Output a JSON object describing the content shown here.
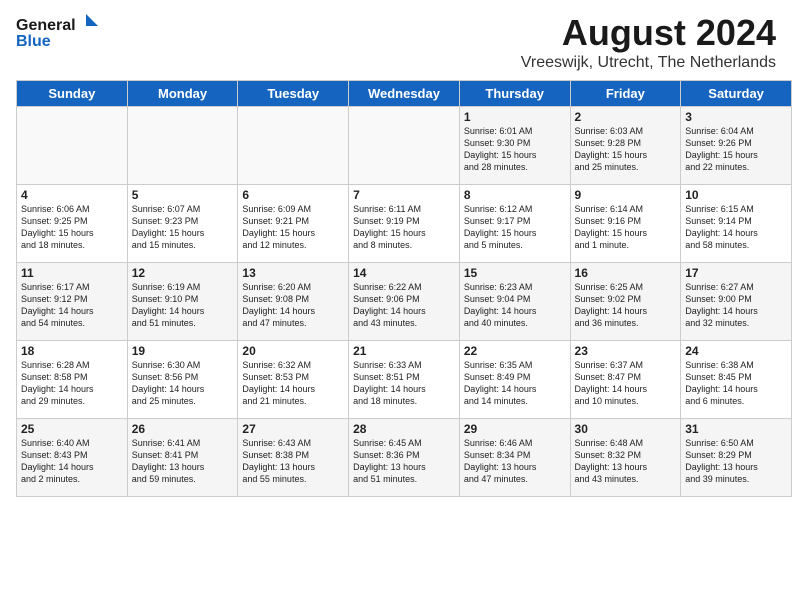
{
  "header": {
    "logo_general": "General",
    "logo_blue": "Blue",
    "main_title": "August 2024",
    "subtitle": "Vreeswijk, Utrecht, The Netherlands"
  },
  "weekdays": [
    "Sunday",
    "Monday",
    "Tuesday",
    "Wednesday",
    "Thursday",
    "Friday",
    "Saturday"
  ],
  "weeks": [
    [
      {
        "day": "",
        "info": ""
      },
      {
        "day": "",
        "info": ""
      },
      {
        "day": "",
        "info": ""
      },
      {
        "day": "",
        "info": ""
      },
      {
        "day": "1",
        "info": "Sunrise: 6:01 AM\nSunset: 9:30 PM\nDaylight: 15 hours\nand 28 minutes."
      },
      {
        "day": "2",
        "info": "Sunrise: 6:03 AM\nSunset: 9:28 PM\nDaylight: 15 hours\nand 25 minutes."
      },
      {
        "day": "3",
        "info": "Sunrise: 6:04 AM\nSunset: 9:26 PM\nDaylight: 15 hours\nand 22 minutes."
      }
    ],
    [
      {
        "day": "4",
        "info": "Sunrise: 6:06 AM\nSunset: 9:25 PM\nDaylight: 15 hours\nand 18 minutes."
      },
      {
        "day": "5",
        "info": "Sunrise: 6:07 AM\nSunset: 9:23 PM\nDaylight: 15 hours\nand 15 minutes."
      },
      {
        "day": "6",
        "info": "Sunrise: 6:09 AM\nSunset: 9:21 PM\nDaylight: 15 hours\nand 12 minutes."
      },
      {
        "day": "7",
        "info": "Sunrise: 6:11 AM\nSunset: 9:19 PM\nDaylight: 15 hours\nand 8 minutes."
      },
      {
        "day": "8",
        "info": "Sunrise: 6:12 AM\nSunset: 9:17 PM\nDaylight: 15 hours\nand 5 minutes."
      },
      {
        "day": "9",
        "info": "Sunrise: 6:14 AM\nSunset: 9:16 PM\nDaylight: 15 hours\nand 1 minute."
      },
      {
        "day": "10",
        "info": "Sunrise: 6:15 AM\nSunset: 9:14 PM\nDaylight: 14 hours\nand 58 minutes."
      }
    ],
    [
      {
        "day": "11",
        "info": "Sunrise: 6:17 AM\nSunset: 9:12 PM\nDaylight: 14 hours\nand 54 minutes."
      },
      {
        "day": "12",
        "info": "Sunrise: 6:19 AM\nSunset: 9:10 PM\nDaylight: 14 hours\nand 51 minutes."
      },
      {
        "day": "13",
        "info": "Sunrise: 6:20 AM\nSunset: 9:08 PM\nDaylight: 14 hours\nand 47 minutes."
      },
      {
        "day": "14",
        "info": "Sunrise: 6:22 AM\nSunset: 9:06 PM\nDaylight: 14 hours\nand 43 minutes."
      },
      {
        "day": "15",
        "info": "Sunrise: 6:23 AM\nSunset: 9:04 PM\nDaylight: 14 hours\nand 40 minutes."
      },
      {
        "day": "16",
        "info": "Sunrise: 6:25 AM\nSunset: 9:02 PM\nDaylight: 14 hours\nand 36 minutes."
      },
      {
        "day": "17",
        "info": "Sunrise: 6:27 AM\nSunset: 9:00 PM\nDaylight: 14 hours\nand 32 minutes."
      }
    ],
    [
      {
        "day": "18",
        "info": "Sunrise: 6:28 AM\nSunset: 8:58 PM\nDaylight: 14 hours\nand 29 minutes."
      },
      {
        "day": "19",
        "info": "Sunrise: 6:30 AM\nSunset: 8:56 PM\nDaylight: 14 hours\nand 25 minutes."
      },
      {
        "day": "20",
        "info": "Sunrise: 6:32 AM\nSunset: 8:53 PM\nDaylight: 14 hours\nand 21 minutes."
      },
      {
        "day": "21",
        "info": "Sunrise: 6:33 AM\nSunset: 8:51 PM\nDaylight: 14 hours\nand 18 minutes."
      },
      {
        "day": "22",
        "info": "Sunrise: 6:35 AM\nSunset: 8:49 PM\nDaylight: 14 hours\nand 14 minutes."
      },
      {
        "day": "23",
        "info": "Sunrise: 6:37 AM\nSunset: 8:47 PM\nDaylight: 14 hours\nand 10 minutes."
      },
      {
        "day": "24",
        "info": "Sunrise: 6:38 AM\nSunset: 8:45 PM\nDaylight: 14 hours\nand 6 minutes."
      }
    ],
    [
      {
        "day": "25",
        "info": "Sunrise: 6:40 AM\nSunset: 8:43 PM\nDaylight: 14 hours\nand 2 minutes."
      },
      {
        "day": "26",
        "info": "Sunrise: 6:41 AM\nSunset: 8:41 PM\nDaylight: 13 hours\nand 59 minutes."
      },
      {
        "day": "27",
        "info": "Sunrise: 6:43 AM\nSunset: 8:38 PM\nDaylight: 13 hours\nand 55 minutes."
      },
      {
        "day": "28",
        "info": "Sunrise: 6:45 AM\nSunset: 8:36 PM\nDaylight: 13 hours\nand 51 minutes."
      },
      {
        "day": "29",
        "info": "Sunrise: 6:46 AM\nSunset: 8:34 PM\nDaylight: 13 hours\nand 47 minutes."
      },
      {
        "day": "30",
        "info": "Sunrise: 6:48 AM\nSunset: 8:32 PM\nDaylight: 13 hours\nand 43 minutes."
      },
      {
        "day": "31",
        "info": "Sunrise: 6:50 AM\nSunset: 8:29 PM\nDaylight: 13 hours\nand 39 minutes."
      }
    ]
  ]
}
